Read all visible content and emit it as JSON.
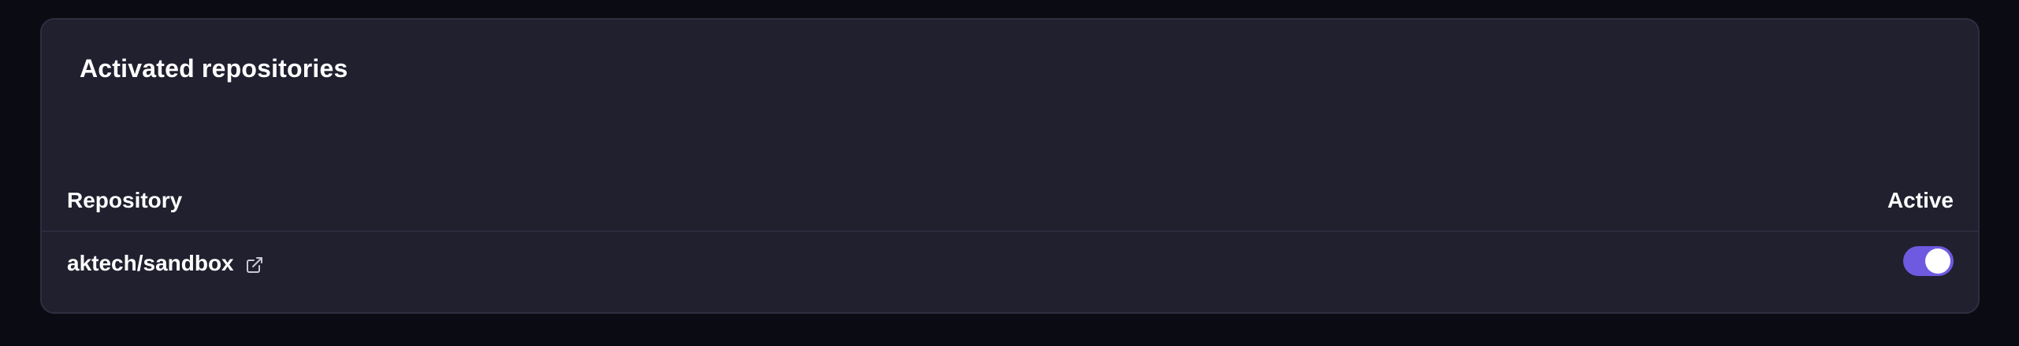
{
  "card": {
    "title": "Activated repositories"
  },
  "table": {
    "columns": [
      "Repository",
      "Active"
    ],
    "rows": [
      {
        "repository": "aktech/sandbox",
        "link_icon": "external-link-icon",
        "active": true
      }
    ]
  },
  "colors": {
    "page_background": "#0b0b14",
    "card_background": "#21202f",
    "toggle_on": "#6e5ae0"
  }
}
